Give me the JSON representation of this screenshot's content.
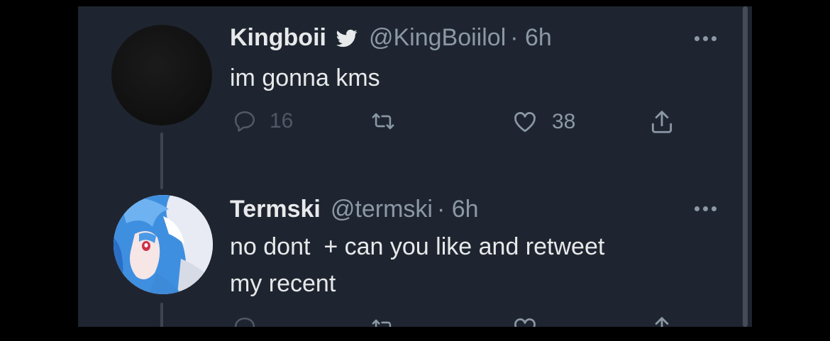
{
  "tweets": [
    {
      "display_name": "Kingboii",
      "verified": true,
      "handle": "@KingBoiilol",
      "time": "· 6h",
      "text": "im gonna kms",
      "replies": "16",
      "likes": "38",
      "avatar": "dark-circle-avatar"
    },
    {
      "display_name": "Termski",
      "verified": false,
      "handle": "@termski",
      "time": "· 6h",
      "text": "no dont  + can you like and retweet\nmy recent",
      "avatar": "anime-character-avatar"
    }
  ],
  "icons": {
    "reply": "reply-icon",
    "retweet": "retweet-icon",
    "like": "heart-icon",
    "share": "share-icon",
    "more": "more-dots-icon",
    "verified": "twitter-bird-icon"
  },
  "colors": {
    "background": "#1f2530",
    "text": "#e7e9ea",
    "secondary": "#8b98a5",
    "thread_line": "#3e4551",
    "outer_frame": "#000000"
  }
}
